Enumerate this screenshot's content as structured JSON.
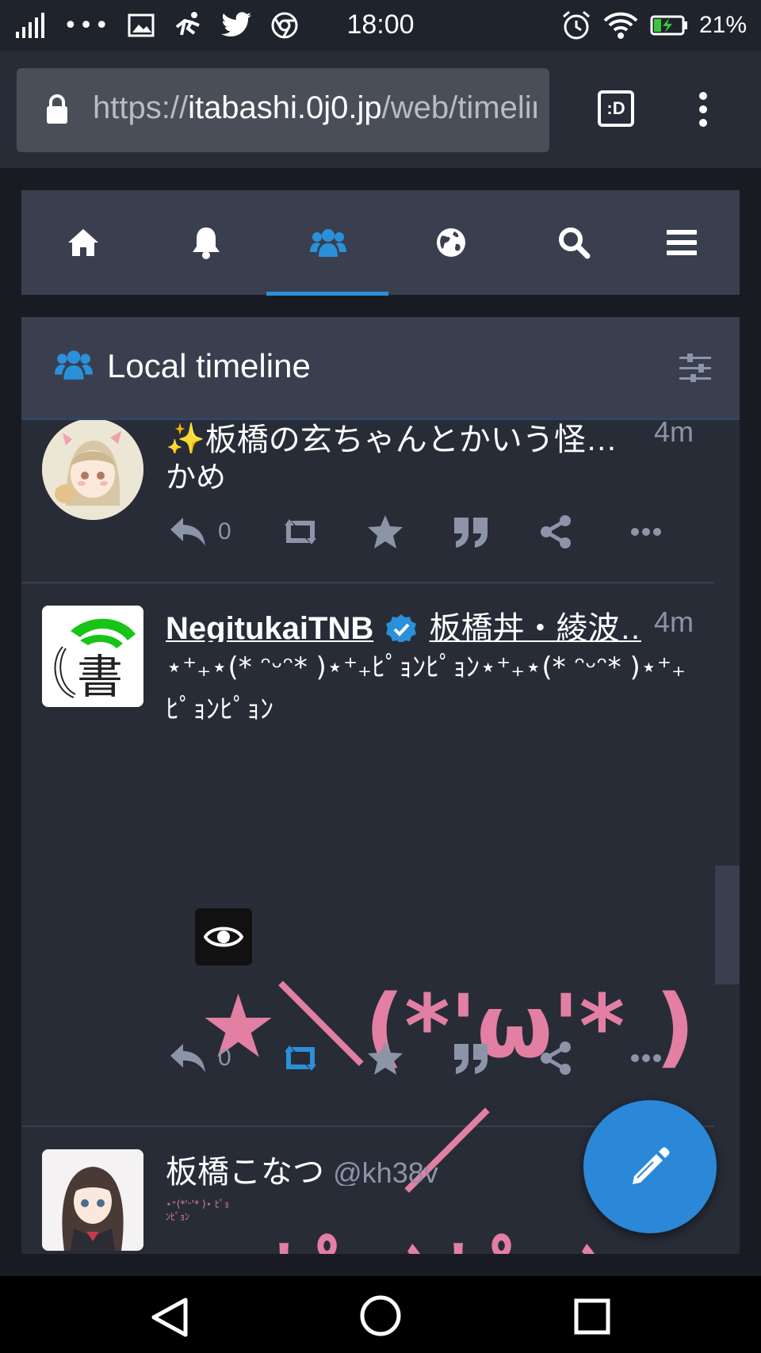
{
  "status_bar": {
    "time": "18:00",
    "battery": "21%",
    "dots": "•••"
  },
  "browser": {
    "url_scheme": "https://",
    "url_host": "itabashi.0j0.jp",
    "url_path": "/web/timelines/public/local",
    "tabs_label": ":D"
  },
  "nav": {
    "items": [
      "home-icon",
      "bell-icon",
      "users-icon",
      "globe-icon",
      "search-icon",
      "menu-icon"
    ],
    "active": "users-icon",
    "accent": "#2b90d9"
  },
  "column": {
    "title": "Local timeline"
  },
  "statuses": [
    {
      "display_name": "✨板橋の玄ちゃんとかいう怪…",
      "time": "4m",
      "content": "かめ",
      "reply_count": "0"
    },
    {
      "display_name": "NegitukaiTNB",
      "verified": true,
      "handle_display": "板橋丼・綾波…",
      "time": "4m",
      "content": "⋆⁺₊⋆(* ︎ᵔᵕᵔ︎* )⋆⁺₊ﾋﾟｮﾝﾋﾟｮﾝ⋆⁺₊⋆(* ︎ᵔᵕᵔ︎* )⋆⁺₊ﾋﾟｮﾝﾋﾟｮﾝ",
      "media_line1": "★＼(*'ω'* )／",
      "media_line2": "ﾋﾟｮﾝﾋﾟｮﾝ",
      "reply_count": "0",
      "reblogged": true
    },
    {
      "display_name": "板橋こなつ",
      "handle": "@kh38v",
      "content_small": "⋆⁺(*'ᵕ'* )⋆ ﾋﾟｮﾝﾋﾟｮﾝ"
    }
  ],
  "fab": {
    "icon": "pencil-icon",
    "color": "#2b88d8"
  }
}
